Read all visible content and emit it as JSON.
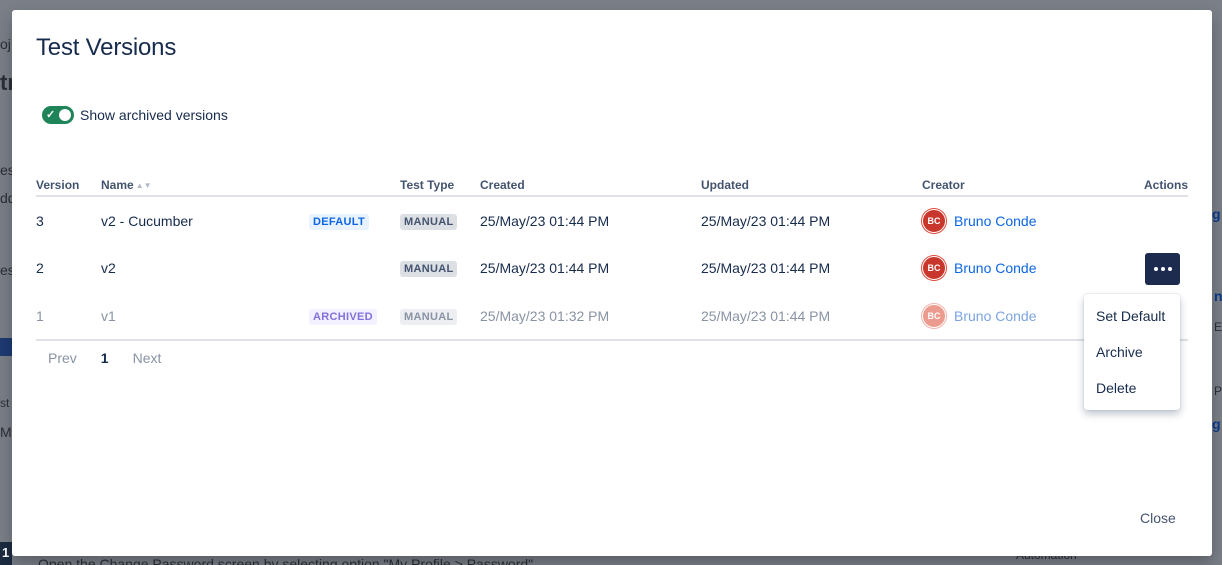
{
  "background": {
    "fragments": [
      "oj",
      "tr",
      "es",
      "dd",
      "est",
      "st",
      "M",
      "1",
      "Open the Change Password screen by selecting option \"My Profile > Password\"",
      "Automation",
      "g",
      "n",
      "E",
      "P",
      "g"
    ]
  },
  "modal": {
    "title": "Test Versions",
    "toggle": {
      "label": "Show archived versions",
      "checked": true,
      "color": "#1f845a"
    },
    "table": {
      "headers": {
        "version": "Version",
        "name": "Name",
        "test_type": "Test Type",
        "created": "Created",
        "updated": "Updated",
        "creator": "Creator",
        "actions": "Actions"
      },
      "rows": [
        {
          "version": "3",
          "name": "v2 - Cucumber",
          "badge": "DEFAULT",
          "test_type": "MANUAL",
          "created": "25/May/23 01:44 PM",
          "updated": "25/May/23 01:44 PM",
          "creator_initials": "BC",
          "creator": "Bruno Conde"
        },
        {
          "version": "2",
          "name": "v2",
          "badge": "",
          "test_type": "MANUAL",
          "created": "25/May/23 01:44 PM",
          "updated": "25/May/23 01:44 PM",
          "creator_initials": "BC",
          "creator": "Bruno Conde"
        },
        {
          "version": "1",
          "name": "v1",
          "badge": "ARCHIVED",
          "test_type": "MANUAL",
          "created": "25/May/23 01:32 PM",
          "updated": "25/May/23 01:44 PM",
          "creator_initials": "BC",
          "creator": "Bruno Conde"
        }
      ]
    },
    "actions_menu": {
      "icon": "more-horizontal-icon",
      "items": [
        "Set Default",
        "Archive",
        "Delete"
      ]
    },
    "pagination": {
      "prev": "Prev",
      "current": "1",
      "next": "Next"
    },
    "close_label": "Close"
  },
  "colors": {
    "accent": "#0c66e4",
    "primary_button": "#1d2b4f",
    "avatar": "#c9372c"
  }
}
